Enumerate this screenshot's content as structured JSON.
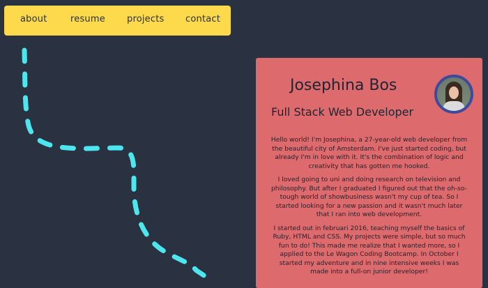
{
  "nav": {
    "items": [
      {
        "label": "about"
      },
      {
        "label": "resume"
      },
      {
        "label": "projects"
      },
      {
        "label": "contact"
      }
    ]
  },
  "colors": {
    "background": "#2a3140",
    "nav_background": "#fdd94c",
    "card_background": "#dd6a6c",
    "path_color": "#4de6ef",
    "avatar_border": "#3e4a9c"
  },
  "profile": {
    "name": "Josephina Bos",
    "title": "Full Stack Web Developer",
    "avatar_icon": "profile-photo",
    "bio": [
      "Hello world! I'm Josephina, a 27-year-old web developer from the beautiful city of Amsterdam. I've just started coding, but already I'm in love with it. It's the combination of logic and creativity that has gotten me hooked.",
      "I loved going to uni and doing research on television and philosophy. But after I graduated I figured out that the oh-so-tough world of showbusiness wasn't my cup of tea. So I started looking for a new passion and it wasn't much later that I ran into web development.",
      "I started out in februari 2016, teaching myself the basics of Ruby, HTML and CSS. My projects were simple, but so much fun to do! This made me realize that I wanted more, so I applied to the Le Wagon Coding Bootcamp. In October I started my adventure and in nine intensive weeks I was made into a full-on junior developer!"
    ]
  }
}
